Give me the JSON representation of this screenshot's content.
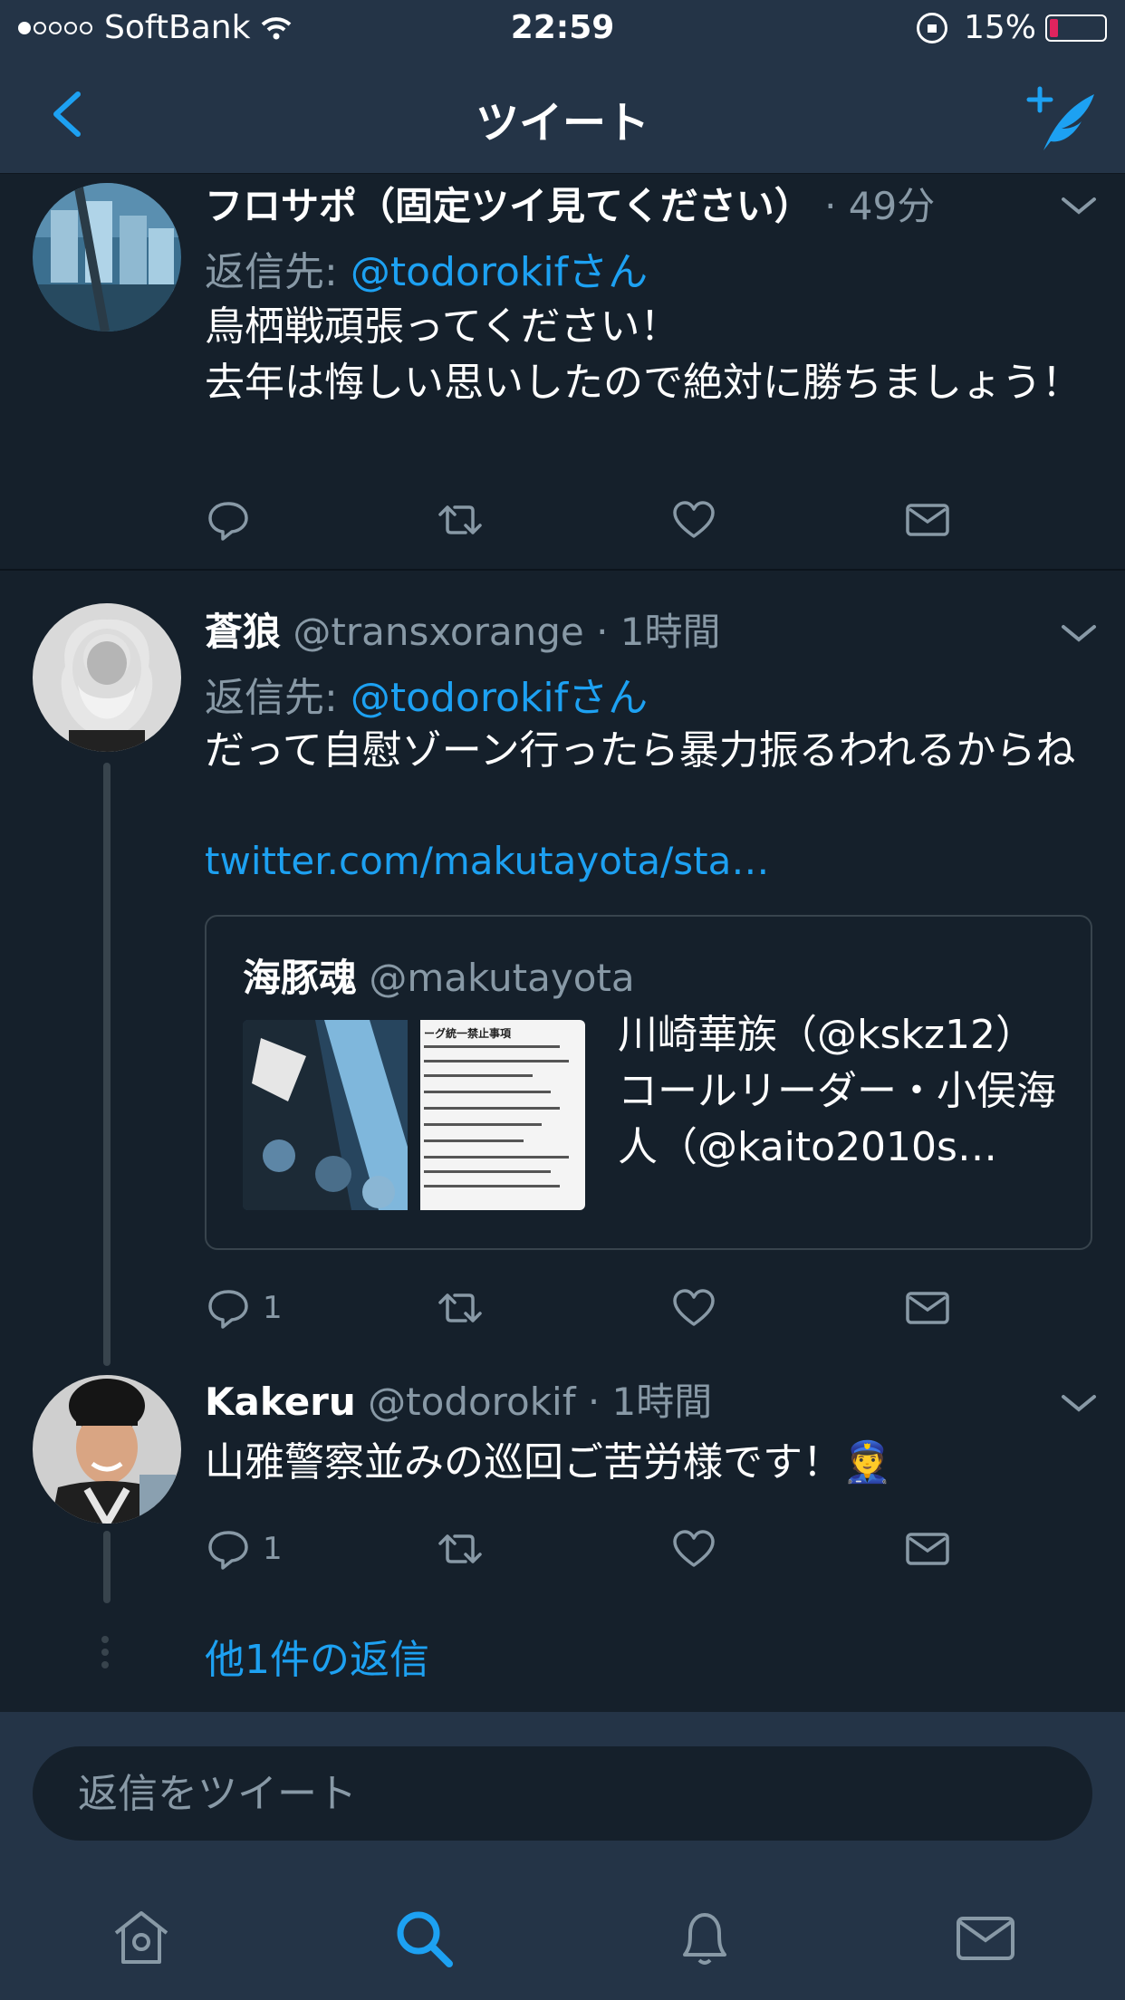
{
  "status_bar": {
    "signal_dots_filled": 1,
    "signal_dots_total": 5,
    "carrier": "SoftBank",
    "time": "22:59",
    "battery": "15%",
    "battery_level": 0.15
  },
  "nav": {
    "title": "ツイート",
    "back_icon": "chevron-left-icon",
    "compose_icon": "compose-tweet-icon"
  },
  "tweets": [
    {
      "name": "フロサポ（固定ツイ見てください）",
      "meta": "· 49分",
      "reply_prefix": "返信先: ",
      "reply_mention": "@todorokifさん",
      "text": "鳥栖戦頑張ってください！\n去年は悔しい思いしたので絶対に勝ちましょう！",
      "reply_count": ""
    },
    {
      "name": "蒼狼",
      "handle": "@transxorange",
      "meta": "· 1時間",
      "reply_prefix": "返信先: ",
      "reply_mention": "@todorokifさん",
      "text": "だって自慰ゾーン行ったら暴力振るわれるからね",
      "link": "twitter.com/makutayota/sta…",
      "quote": {
        "name": "海豚魂",
        "handle": "@makutayota",
        "text": "川崎華族（@kskz12）コールリーダー・小俣海人（@kaito2010s…",
        "image_title": "ーグ統一禁止事項"
      },
      "reply_count": "1"
    },
    {
      "name": "Kakeru",
      "handle": "@todorokif",
      "meta": "· 1時間",
      "text": "山雅警察並みの巡回ご苦労様です！👮",
      "reply_count": "1"
    }
  ],
  "more_replies": "他1件の返信",
  "reply_input": {
    "placeholder": "返信をツイート"
  },
  "tabs": [
    "home-icon",
    "search-icon",
    "notifications-icon",
    "messages-icon"
  ],
  "colors": {
    "background": "#15202b",
    "bar": "#243447",
    "accent": "#1da1f2",
    "muted": "#8899a6",
    "battery_low": "#e0245e"
  }
}
